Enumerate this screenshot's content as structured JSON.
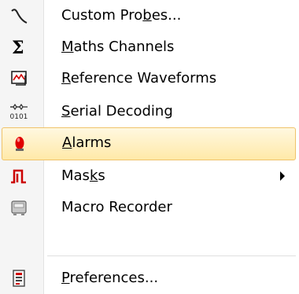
{
  "menu": {
    "items": [
      {
        "pre": "Custom Pro",
        "u": "b",
        "post": "es...",
        "icon": "custom-probes-icon"
      },
      {
        "pre": "",
        "u": "M",
        "post": "aths Channels",
        "icon": "sigma-icon"
      },
      {
        "pre": "",
        "u": "R",
        "post": "eference Waveforms",
        "icon": "reference-waveforms-icon"
      },
      {
        "pre": "",
        "u": "S",
        "post": "erial Decoding",
        "icon": "serial-decoding-icon"
      },
      {
        "pre": "",
        "u": "A",
        "post": "larms",
        "icon": "alarms-icon",
        "highlighted": true
      },
      {
        "pre": "Mas",
        "u": "k",
        "post": "s",
        "icon": "masks-icon",
        "has_submenu": true
      },
      {
        "pre": "Macro Recorder",
        "u": "",
        "post": "",
        "icon": "macro-recorder-icon"
      },
      {
        "pre": "",
        "u": "P",
        "post": "references...",
        "icon": "preferences-icon"
      }
    ],
    "serial_icon_text": "0101",
    "colors": {
      "highlight_border": "#f0c36a",
      "highlight_fill": "#ffe9a8",
      "alarm_red": "#e00000",
      "mask_red": "#cc0000"
    }
  }
}
